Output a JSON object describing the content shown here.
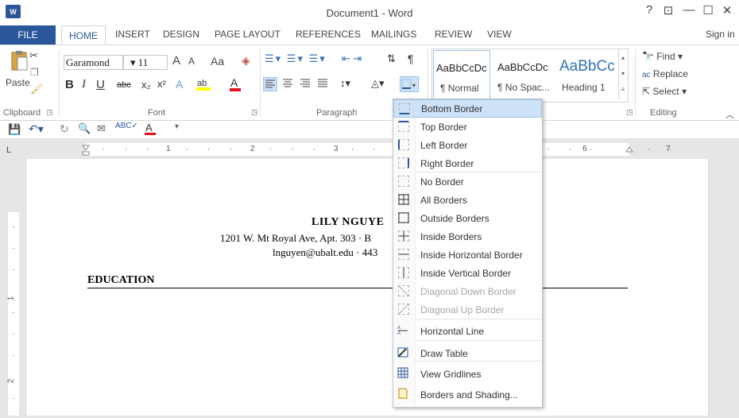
{
  "window": {
    "title": "Document1 - Word",
    "help": "?",
    "controls": [
      "—",
      "☐",
      "✕"
    ],
    "sign_in": "Sign in"
  },
  "tabs": [
    "FILE",
    "HOME",
    "INSERT",
    "DESIGN",
    "PAGE LAYOUT",
    "REFERENCES",
    "MAILINGS",
    "REVIEW",
    "VIEW"
  ],
  "ribbon": {
    "clipboard": {
      "paste": "Paste",
      "label": "Clipboard"
    },
    "font": {
      "name": "Garamond",
      "size": "11",
      "label": "Font",
      "bold": "B",
      "italic": "I",
      "underline": "U",
      "strike": "abc",
      "grow": "A",
      "shrink": "A",
      "case": "Aa"
    },
    "paragraph": {
      "label": "Paragraph"
    },
    "styles": {
      "items": [
        {
          "sample": "AaBbCcDc",
          "name": "¶ Normal"
        },
        {
          "sample": "AaBbCcDc",
          "name": "¶ No Spac..."
        },
        {
          "sample": "AaBbCc",
          "name": "Heading 1"
        }
      ]
    },
    "editing": {
      "find": "Find",
      "replace": "Replace",
      "select": "Select",
      "label": "Editing"
    }
  },
  "ruler": {
    "numbers": [
      "1",
      "2",
      "3",
      "6",
      "7"
    ]
  },
  "vruler": {
    "numbers": [
      "1",
      "2"
    ]
  },
  "document": {
    "name": "LILY NGUYE",
    "address": "1201 W. Mt Royal Ave, Apt. 303 · B",
    "contact": "lnguyen@ubalt.edu · 443",
    "section": "EDUCATION"
  },
  "border_menu": {
    "items": [
      {
        "label": "Bottom Border",
        "enabled": true,
        "highlighted": true
      },
      {
        "label": "Top Border",
        "enabled": true
      },
      {
        "label": "Left Border",
        "enabled": true
      },
      {
        "label": "Right Border",
        "enabled": true
      },
      {
        "label": "No Border",
        "enabled": true
      },
      {
        "label": "All Borders",
        "enabled": true
      },
      {
        "label": "Outside Borders",
        "enabled": true
      },
      {
        "label": "Inside Borders",
        "enabled": true
      },
      {
        "label": "Inside Horizontal Border",
        "enabled": true
      },
      {
        "label": "Inside Vertical Border",
        "enabled": true
      },
      {
        "label": "Diagonal Down Border",
        "enabled": false
      },
      {
        "label": "Diagonal Up Border",
        "enabled": false
      },
      {
        "label": "Horizontal Line",
        "enabled": true
      },
      {
        "label": "Draw Table",
        "enabled": true
      },
      {
        "label": "View Gridlines",
        "enabled": true
      },
      {
        "label": "Borders and Shading...",
        "enabled": true
      }
    ]
  },
  "colors": {
    "accent": "#2b579a",
    "highlight": "#cde1f7",
    "font_color_bar": "#e81123",
    "highlight_bar": "#ffff00"
  }
}
